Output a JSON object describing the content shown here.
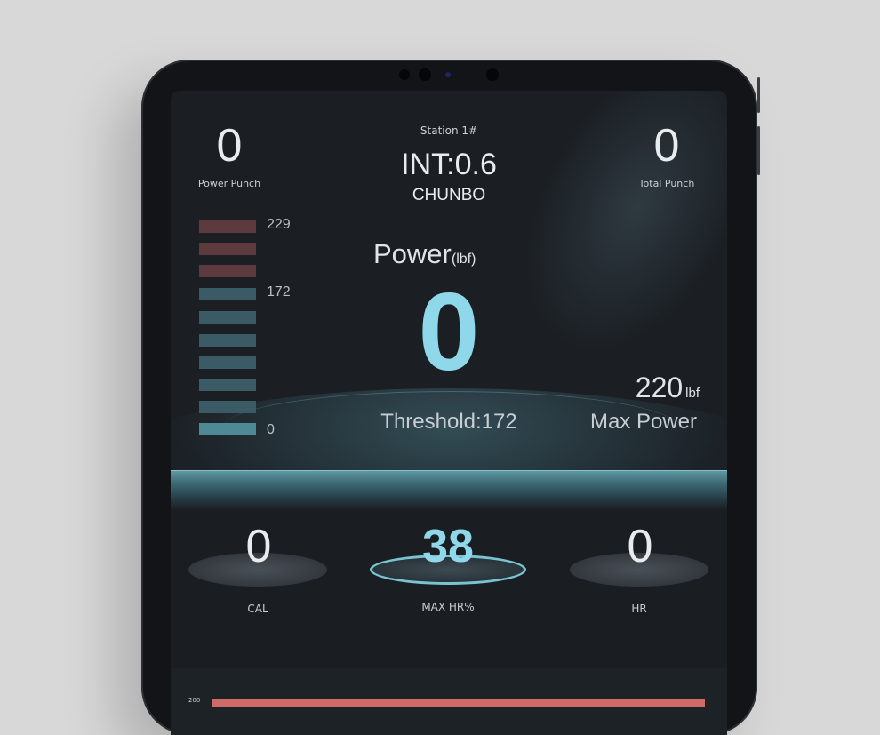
{
  "station": "Station 1#",
  "interval": "INT:0.6",
  "user": "CHUNBO",
  "power_punch": {
    "value": "0",
    "label": "Power Punch"
  },
  "total_punch": {
    "value": "0",
    "label": "Total Punch"
  },
  "power": {
    "label": "Power",
    "unit": "(lbf)",
    "value": "0"
  },
  "threshold": "Threshold:172",
  "max_power": {
    "value": "220",
    "unit": "lbf",
    "label": "Max Power"
  },
  "scale": {
    "top": "229",
    "mid": "172",
    "bottom": "0"
  },
  "metrics": [
    {
      "value": "0",
      "label": "CAL"
    },
    {
      "value": "38",
      "label": "MAX HR%"
    },
    {
      "value": "0",
      "label": "HR"
    }
  ],
  "chart_axis_top": "200",
  "colors": {
    "accent": "#8fd8ea",
    "bar_red": "#5c3a3e",
    "bar_teal": "#3a5b65",
    "chart_bar": "#cf6b67"
  }
}
